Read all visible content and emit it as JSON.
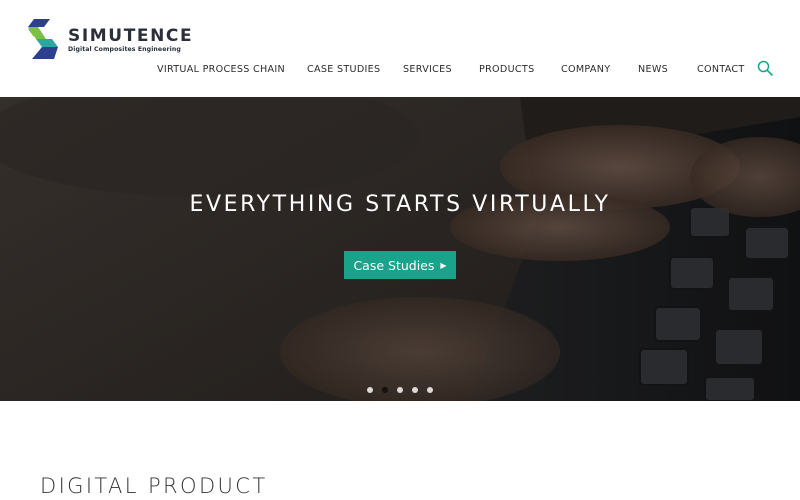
{
  "brand": {
    "name": "SIMUTENCE",
    "tagline": "Digital Composites Engineering",
    "colors": {
      "blue": "#2f3f8f",
      "green": "#7ac143",
      "teal": "#19a38a",
      "navy": "#2b2f3a"
    }
  },
  "nav": {
    "items": [
      {
        "label": "VIRTUAL PROCESS CHAIN"
      },
      {
        "label": "CASE STUDIES"
      },
      {
        "label": "SERVICES"
      },
      {
        "label": "PRODUCTS"
      },
      {
        "label": "COMPANY"
      },
      {
        "label": "NEWS"
      },
      {
        "label": "CONTACT"
      }
    ],
    "search_icon": "search-icon"
  },
  "hero": {
    "title": "EVERYTHING STARTS VIRTUALLY",
    "cta_label": "Case Studies",
    "cta_icon": "triangle-right-icon",
    "cta_color": "#19a38a",
    "slides_total": 5,
    "active_slide": 2
  },
  "section": {
    "title": "DIGITAL PRODUCT"
  }
}
